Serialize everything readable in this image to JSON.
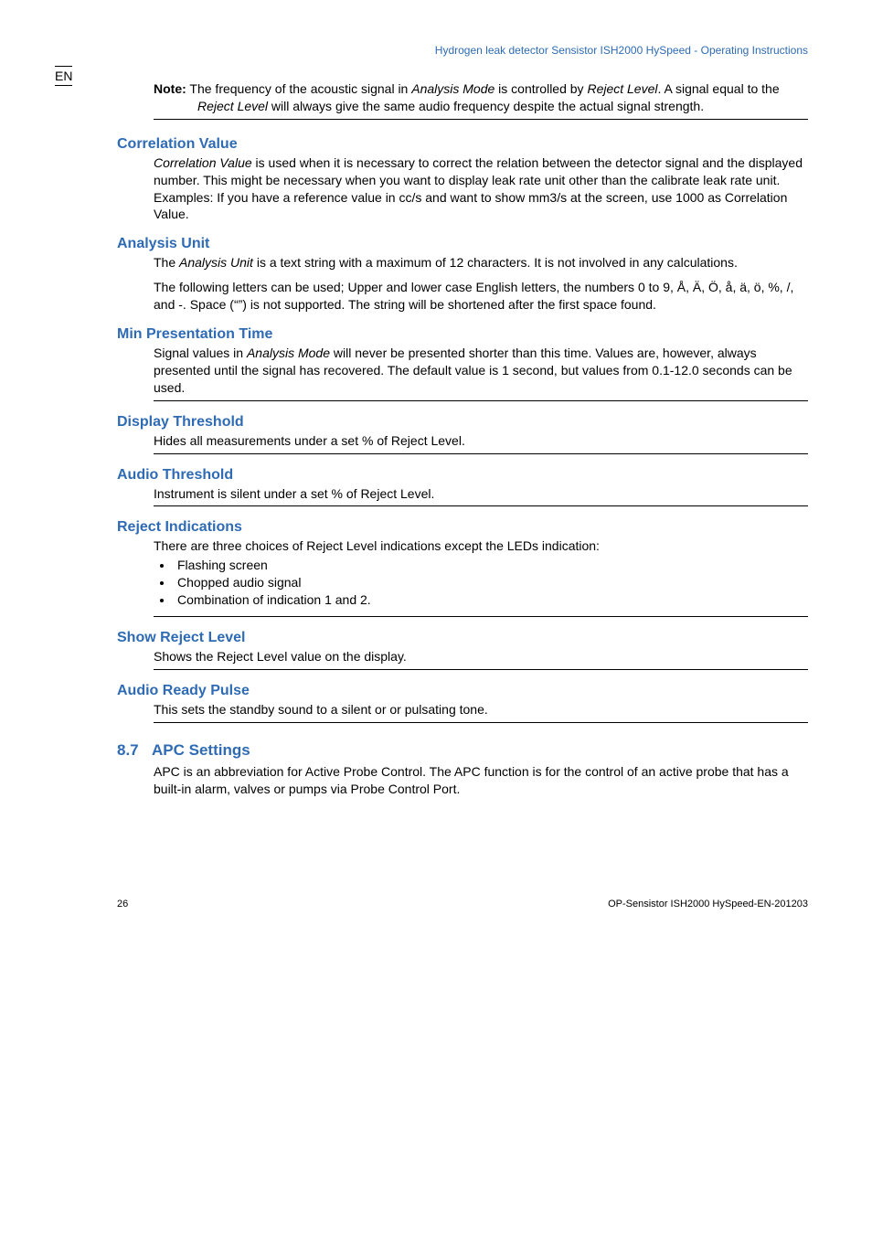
{
  "en_label": "EN",
  "header": "Hydrogen leak detector Sensistor ISH2000 HySpeed - Operating Instructions",
  "note": {
    "label": "Note:",
    "text_a": " The frequency of the acoustic signal in ",
    "mode": "Analysis Mode",
    "text_b": " is controlled by ",
    "level1": "Reject Level",
    "text_c": ". A signal equal to the ",
    "level2": "Reject Level",
    "text_d": " will always give the same audio frequency despite the actual signal strength."
  },
  "sections": {
    "correlation": {
      "title": "Correlation Value",
      "term": "Correlation Value",
      "body": "  is used when it is necessary to correct the relation between the detector signal and the displayed number. This might be necessary when you want to display leak rate unit other than the calibrate leak rate unit. Examples: If you have a reference value in cc/s and want to show mm3/s at the screen, use 1000 as Correlation Value."
    },
    "analysis_unit": {
      "title": "Analysis Unit",
      "p1a": "The ",
      "p1term": "Analysis Unit",
      "p1b": " is a text string with a maximum of 12 characters. It is not involved in any calculations.",
      "p2": "The following letters can be used; Upper and lower case English letters, the numbers 0 to 9, Å, Ä, Ö, å, ä, ö, %, /, and -. Space (“”) is not supported. The string will be shortened after the first space found."
    },
    "min_presentation": {
      "title": "Min Presentation Time",
      "p_a": "Signal values in ",
      "term": "Analysis Mode",
      "p_b": " will never be presented shorter than this time. Values are, however, always presented until the signal has recovered. The default value is 1 second, but values from 0.1-12.0 seconds can be used."
    },
    "display_threshold": {
      "title": "Display Threshold",
      "body": "Hides all measurements under a set % of Reject Level."
    },
    "audio_threshold": {
      "title": "Audio Threshold",
      "body": "Instrument is silent under a set % of Reject Level."
    },
    "reject_indications": {
      "title": "Reject Indications",
      "intro": "There are three choices of Reject Level indications except the LEDs indication:",
      "items": [
        "Flashing screen",
        "Chopped audio signal",
        "Combination of indication 1 and 2."
      ]
    },
    "show_reject": {
      "title": "Show Reject Level",
      "body": "Shows the Reject Level value on the display."
    },
    "audio_ready": {
      "title": "Audio Ready Pulse",
      "body": "This sets the standby sound to a silent or or pulsating tone."
    },
    "apc": {
      "num": "8.7",
      "title": "APC Settings",
      "body": "APC is an abbreviation for Active Probe Control. The APC function is for the control of an active probe that has a built-in alarm, valves or pumps via Probe Control Port."
    }
  },
  "footer": {
    "page": "26",
    "doccode": "OP-Sensistor ISH2000 HySpeed-EN-201203"
  }
}
